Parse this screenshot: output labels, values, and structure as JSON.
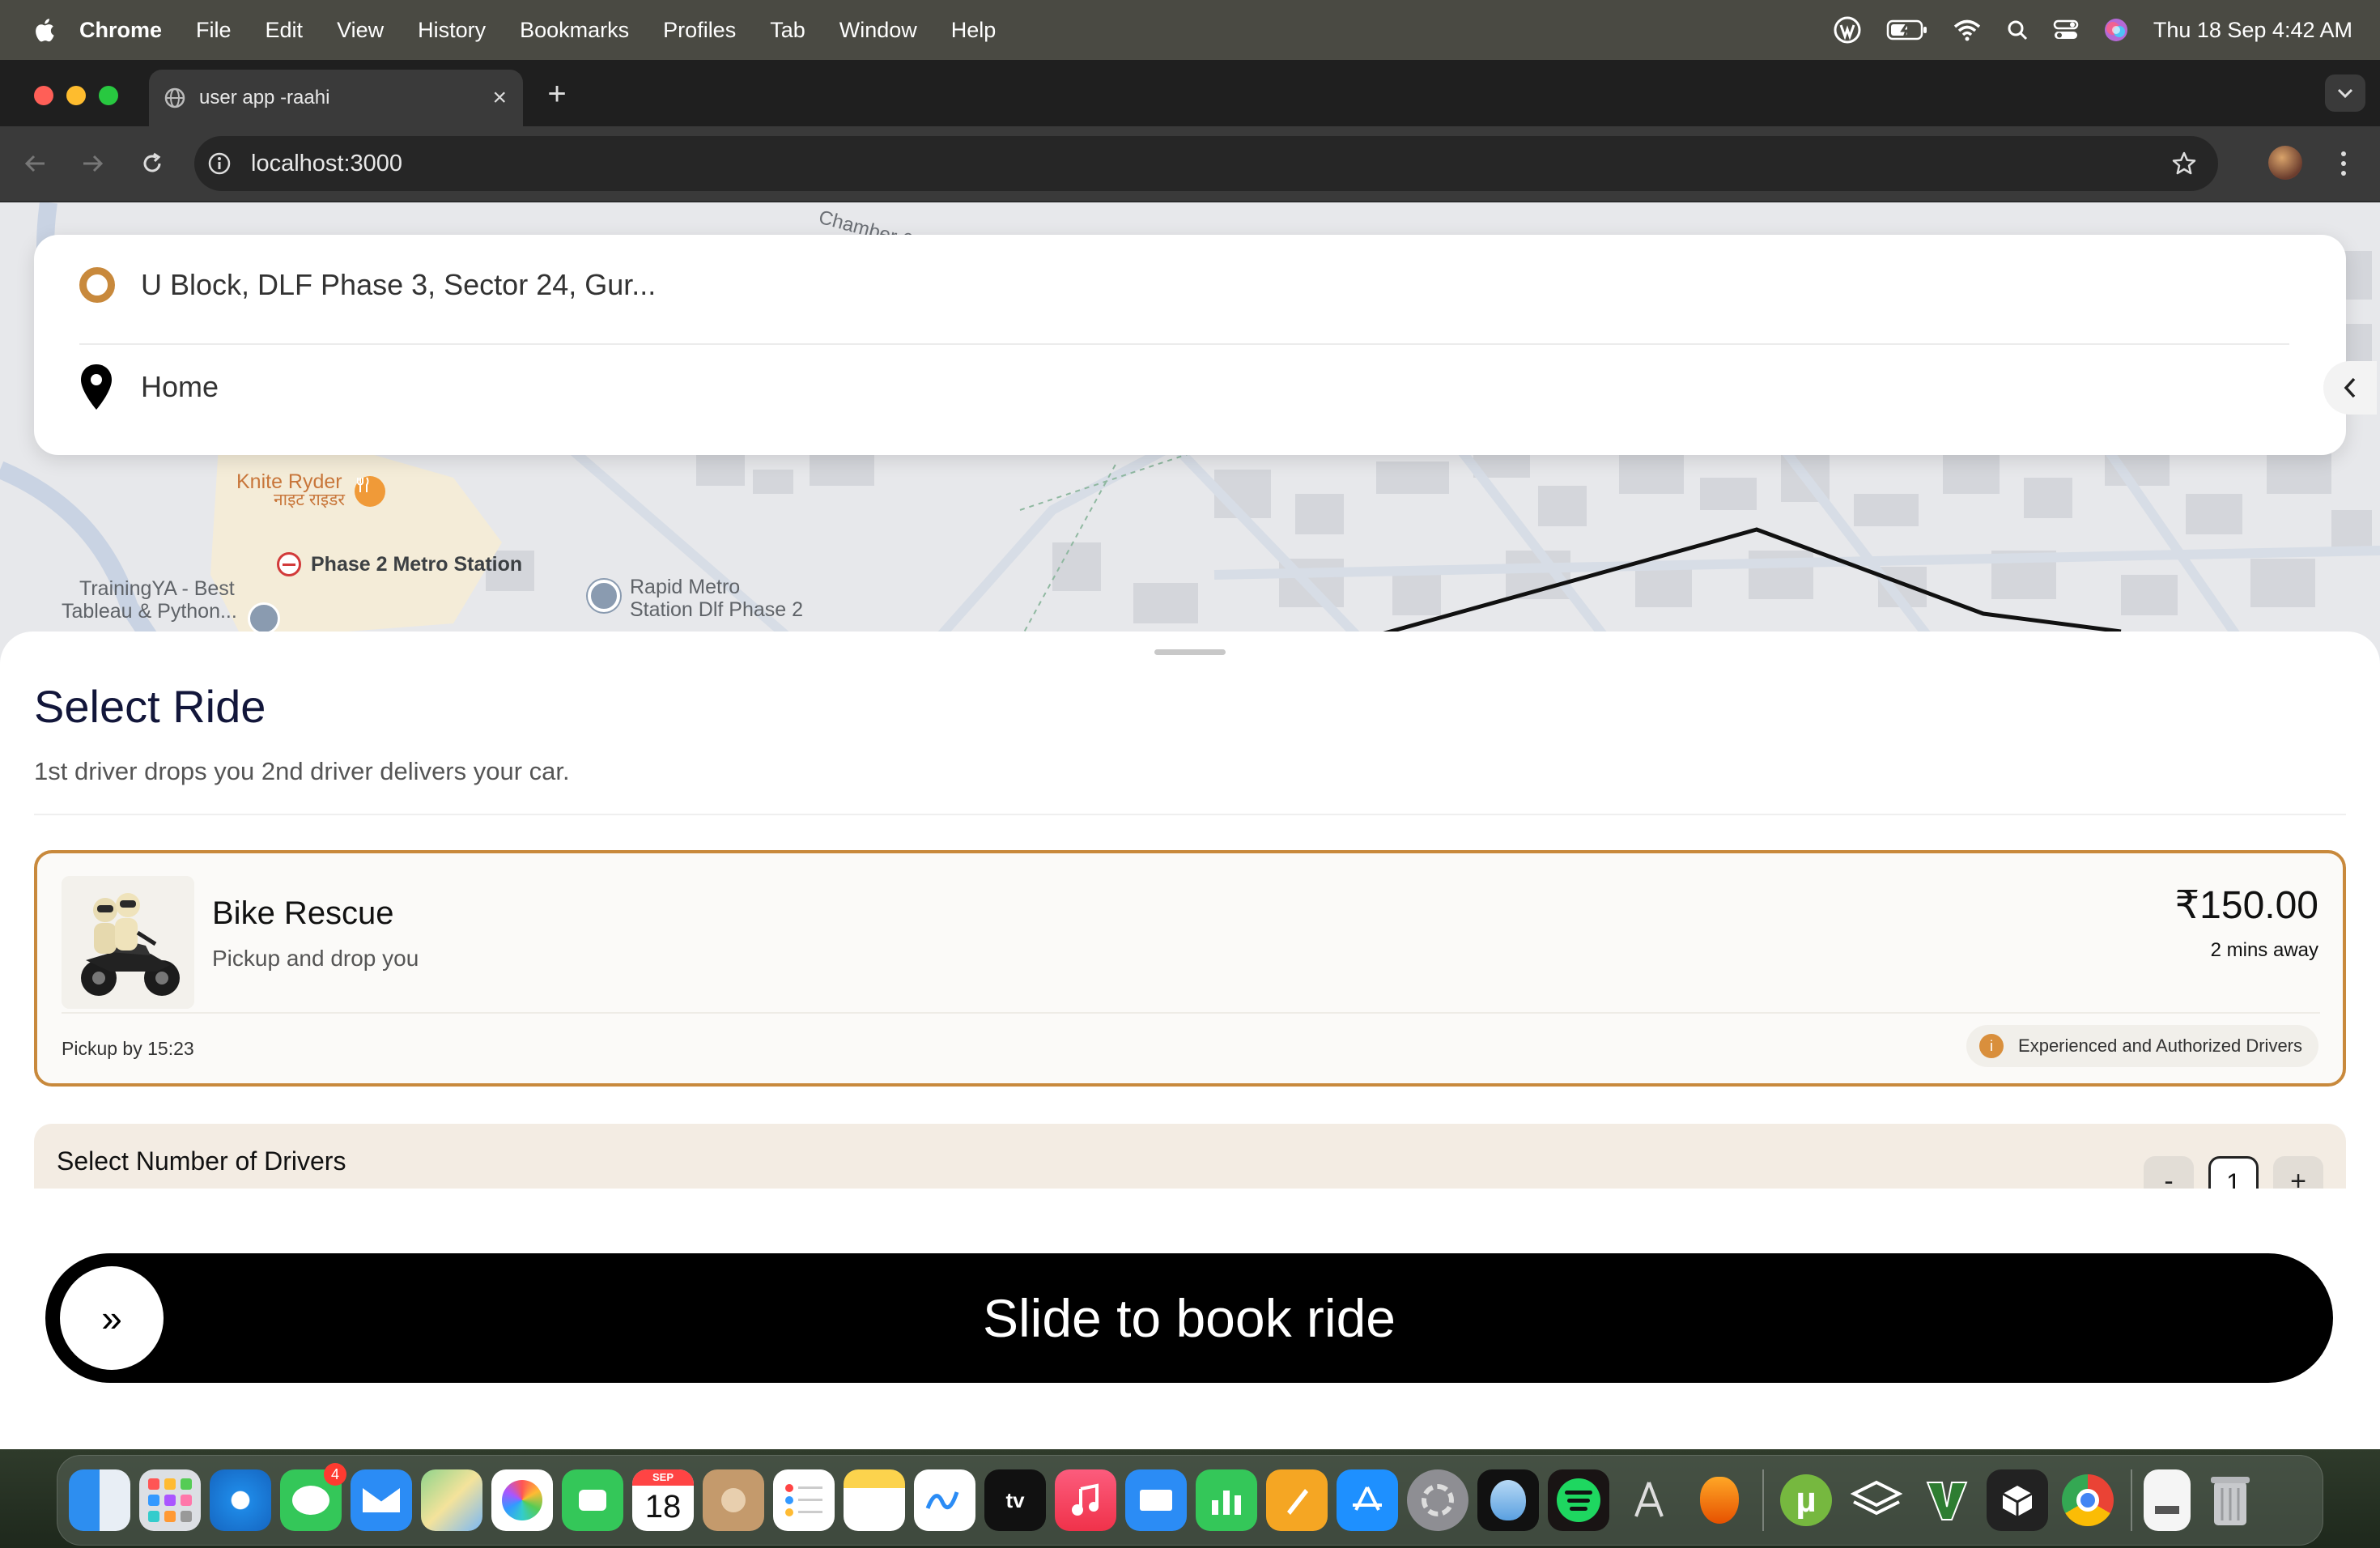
{
  "menubar": {
    "app_name": "Chrome",
    "items": [
      "File",
      "Edit",
      "View",
      "History",
      "Bookmarks",
      "Profiles",
      "Tab",
      "Window",
      "Help"
    ],
    "clock": "Thu 18 Sep  4:42 AM"
  },
  "browser": {
    "tab_title": "user app -raahi",
    "url": "localhost:3000"
  },
  "map": {
    "labels": {
      "restaurant": "Knite Ryder",
      "restaurant_hindi": "नाइट राइडर",
      "metro": "Phase 2 Metro Station",
      "training_line1": "TrainingYA - Best",
      "training_line2": "Tableau & Python...",
      "rapid_line1": "Rapid Metro",
      "rapid_line2": "Station Dlf Phase 2"
    }
  },
  "search": {
    "pickup": "U Block, DLF Phase 3, Sector 24, Gur...",
    "destination": "Home"
  },
  "sheet": {
    "title": "Select Ride",
    "subtitle": "1st driver drops you 2nd driver delivers your car."
  },
  "ride": {
    "name": "Bike Rescue",
    "description": "Pickup and drop you",
    "price": "₹150.00",
    "eta": "2 mins away",
    "pickup_time": "Pickup by 15:23",
    "badge": "Experienced and Authorized Drivers",
    "badge_icon": "i"
  },
  "drivers": {
    "label": "Select Number of Drivers",
    "minus": "-",
    "count": "1",
    "plus": "+"
  },
  "booking": {
    "knob": "»",
    "label": "Slide to book ride"
  },
  "dock": {
    "calendar_month": "SEP",
    "calendar_day": "18",
    "messages_badge": "4",
    "tv_label": "tv"
  },
  "colors": {
    "accent": "#c8893c",
    "sheet_title": "#12163a",
    "drivers_panel": "#f3ece3",
    "slider": "#000000"
  }
}
